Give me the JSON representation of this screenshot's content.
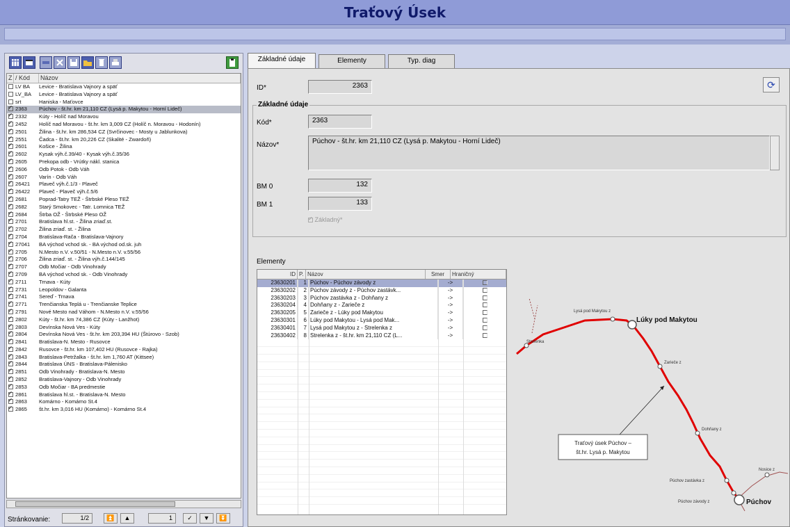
{
  "page_title": "Traťový Úsek",
  "list": {
    "columns": [
      "Z",
      "/ Kód",
      "Názov"
    ],
    "rows": [
      {
        "checked": false,
        "code": "LV BA",
        "name": "Levice - Bratislava Vajnory a späť",
        "selected": false
      },
      {
        "checked": false,
        "code": "LV_BA",
        "name": "Levice - Bratislava Vajnory a späť",
        "selected": false
      },
      {
        "checked": false,
        "code": "srt",
        "name": "Haniska - Maťovce",
        "selected": false
      },
      {
        "checked": true,
        "code": "2363",
        "name": "Púchov - št.hr. km 21,110 CZ (Lysá p. Makytou - Horní Lideč)",
        "selected": true
      },
      {
        "checked": true,
        "code": "2332",
        "name": "Kúty - Holíč nad Moravou",
        "selected": false
      },
      {
        "checked": true,
        "code": "2452",
        "name": "Holíč nad Moravou - št.hr. km 3,009 CZ (Holíč n. Moravou - Hodonín)",
        "selected": false
      },
      {
        "checked": true,
        "code": "2501",
        "name": "Žilina - št.hr. km 286,534 CZ (Svrčinovec - Mosty u Jablunkova)",
        "selected": false
      },
      {
        "checked": true,
        "code": "2551",
        "name": "Čadca - št.hr. km 20,226 CZ (Skalité - Zwardoň)",
        "selected": false
      },
      {
        "checked": true,
        "code": "2601",
        "name": "Košice - Žilina",
        "selected": false
      },
      {
        "checked": true,
        "code": "2602",
        "name": "Kysak výh.č.39/40 - Kysak výh.č.35/36",
        "selected": false
      },
      {
        "checked": true,
        "code": "2605",
        "name": "Prekopa odb - Vrútky nákl. stanica",
        "selected": false
      },
      {
        "checked": true,
        "code": "2606",
        "name": "Odb Potok - Odb Váh",
        "selected": false
      },
      {
        "checked": true,
        "code": "2607",
        "name": "Varín - Odb Váh",
        "selected": false
      },
      {
        "checked": true,
        "code": "26421",
        "name": "Plaveč výh.č.1/3 - Plaveč",
        "selected": false
      },
      {
        "checked": true,
        "code": "26422",
        "name": "Plaveč - Plaveč výh.č.5/6",
        "selected": false
      },
      {
        "checked": true,
        "code": "2681",
        "name": "Poprad-Tatry TEŽ - Štrbské Pleso TEŽ",
        "selected": false
      },
      {
        "checked": true,
        "code": "2682",
        "name": "Starý Smokovec - Tatr. Lomnica TEŽ",
        "selected": false
      },
      {
        "checked": true,
        "code": "2684",
        "name": "Štrba OŽ - Štrbské Pleso OŽ",
        "selected": false
      },
      {
        "checked": true,
        "code": "2701",
        "name": "Bratislava hl.st. - Žilina zriaď.st.",
        "selected": false
      },
      {
        "checked": true,
        "code": "2702",
        "name": "Žilina zriaď. st. - Žilina",
        "selected": false
      },
      {
        "checked": true,
        "code": "2704",
        "name": "Bratislava-Rača - Bratislava-Vajnory",
        "selected": false
      },
      {
        "checked": true,
        "code": "27041",
        "name": "BA východ vchod sk. - BA východ od.sk. juh",
        "selected": false
      },
      {
        "checked": true,
        "code": "2705",
        "name": "N.Mesto n.V. v.50/51 - N.Mesto n.V. v.55/56",
        "selected": false
      },
      {
        "checked": true,
        "code": "2706",
        "name": "Žilina zriaď. st. - Žilina výh.č.144/145",
        "selected": false
      },
      {
        "checked": true,
        "code": "2707",
        "name": "Odb Močiar - Odb Vinohrady",
        "selected": false
      },
      {
        "checked": true,
        "code": "2709",
        "name": "BA východ vchod sk. - Odb Vinohrady",
        "selected": false
      },
      {
        "checked": true,
        "code": "2711",
        "name": "Trnava - Kúty",
        "selected": false
      },
      {
        "checked": true,
        "code": "2731",
        "name": "Leopoldov - Galanta",
        "selected": false
      },
      {
        "checked": true,
        "code": "2741",
        "name": "Sereď - Trnava",
        "selected": false
      },
      {
        "checked": true,
        "code": "2771",
        "name": "Trenčianska Teplá u - Trenčianske Teplice",
        "selected": false
      },
      {
        "checked": true,
        "code": "2791",
        "name": "Nové Mesto nad Váhom - N.Mesto n.V. v.55/56",
        "selected": false
      },
      {
        "checked": true,
        "code": "2802",
        "name": "Kúty - št.hr. km 74,386 CZ (Kúty - Lanžhot)",
        "selected": false
      },
      {
        "checked": true,
        "code": "2803",
        "name": "Devínska Nová Ves - Kúty",
        "selected": false
      },
      {
        "checked": true,
        "code": "2804",
        "name": "Devínska Nová Ves - št.hr. km 203,394 HU (Štúrovo - Szob)",
        "selected": false
      },
      {
        "checked": true,
        "code": "2841",
        "name": "Bratislava-N. Mesto - Rusovce",
        "selected": false
      },
      {
        "checked": true,
        "code": "2842",
        "name": "Rusovce - št.hr. km 107,402 HU (Rusovce - Rajka)",
        "selected": false
      },
      {
        "checked": true,
        "code": "2843",
        "name": "Bratislava-Petržalka - št.hr. km 1,760 AT (Kittsee)",
        "selected": false
      },
      {
        "checked": true,
        "code": "2844",
        "name": "Bratislava ÚNS - Bratislava-Pálenisko",
        "selected": false
      },
      {
        "checked": true,
        "code": "2851",
        "name": "Odb Vinohrady - Bratislava-N. Mesto",
        "selected": false
      },
      {
        "checked": true,
        "code": "2852",
        "name": "Bratislava-Vajnory - Odb Vinohrady",
        "selected": false
      },
      {
        "checked": true,
        "code": "2853",
        "name": "Odb Močiar - BA predmestie",
        "selected": false
      },
      {
        "checked": true,
        "code": "2861",
        "name": "Bratislava hl.st. - Bratislava-N. Mesto",
        "selected": false
      },
      {
        "checked": true,
        "code": "2863",
        "name": "Komárno - Komárno St.4",
        "selected": false
      },
      {
        "checked": true,
        "code": "2865",
        "name": "št.hr. km 3,016 HU (Komárno) - Komárno St.4",
        "selected": false
      }
    ]
  },
  "pager": {
    "label": "Stránkovanie:",
    "page": "1/2",
    "step": "1"
  },
  "tabs": [
    "Základné údaje",
    "Elementy",
    "Typ. diag"
  ],
  "form": {
    "id_label": "ID*",
    "id_value": "2363",
    "group_title": "Základné údaje",
    "code_label": "Kód*",
    "code_value": "2363",
    "name_label": "Názov*",
    "name_value": "Púchov - št.hr. km 21,110 CZ (Lysá p. Makytou - Horní Lideč)",
    "bm0_label": "BM 0",
    "bm0_value": "132",
    "bm1_label": "BM 1",
    "bm1_value": "133",
    "zakladny_label": "Základný*"
  },
  "elements": {
    "title": "Elementy",
    "columns": [
      "ID",
      "P.",
      "Názov",
      "Smer",
      "Hraničný"
    ],
    "rows": [
      {
        "id": "23630201",
        "p": "1",
        "name": "Púchov - Púchov závody z",
        "dir": "->",
        "selected": true
      },
      {
        "id": "23630202",
        "p": "2",
        "name": "Púchov závody z - Púchov zastávk...",
        "dir": "->",
        "selected": false
      },
      {
        "id": "23630203",
        "p": "3",
        "name": "Púchov zastávka z - Dohňany z",
        "dir": "->",
        "selected": false
      },
      {
        "id": "23630204",
        "p": "4",
        "name": "Dohňany z - Zarieče z",
        "dir": "->",
        "selected": false
      },
      {
        "id": "23630205",
        "p": "5",
        "name": "Zarieče z - Lúky pod Makytou",
        "dir": "->",
        "selected": false
      },
      {
        "id": "23630301",
        "p": "6",
        "name": "Lúky pod Makytou - Lysá pod Mak...",
        "dir": "->",
        "selected": false
      },
      {
        "id": "23630401",
        "p": "7",
        "name": "Lysá pod Makytou z - Strelenka z",
        "dir": "->",
        "selected": false
      },
      {
        "id": "23630402",
        "p": "8",
        "name": "Strelenka z - št.hr. km 21,110 CZ (L...",
        "dir": "->",
        "selected": false
      }
    ]
  },
  "map": {
    "labels": {
      "strelenka": "Strelenka",
      "lysa": "Lysá pod Makytou z",
      "luky": "Lúky pod Makytou",
      "zariece": "Zarieče z",
      "dohnany": "Dohňany z",
      "nosice": "Nosice z",
      "puchov_zast": "Púchov zastávka z",
      "puchov_zav": "Púchov závody z",
      "puchov": "Púchov"
    },
    "callout_line1": "Traťový úsek Púchov –",
    "callout_line2": "št.hr. Lysá p. Makytou",
    "route_color": "#e00000"
  }
}
